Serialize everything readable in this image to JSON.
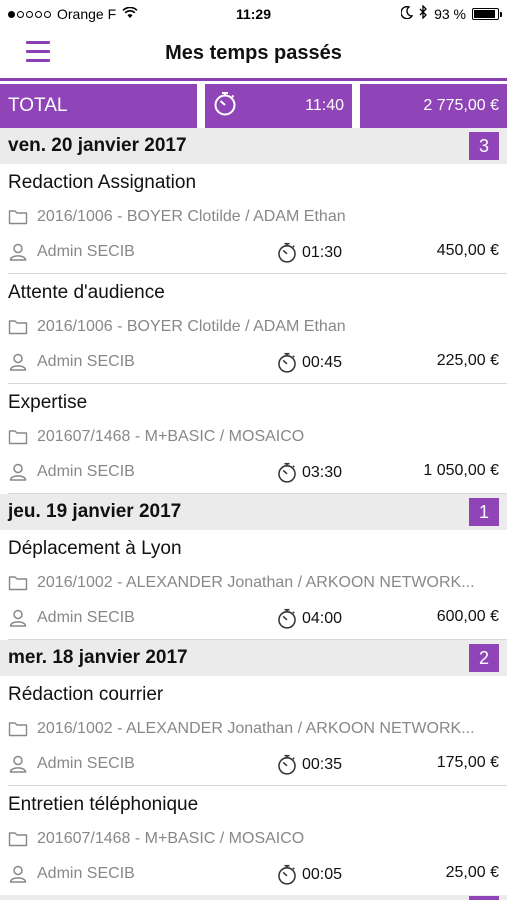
{
  "status_bar": {
    "carrier": "Orange F",
    "time": "11:29",
    "battery": "93 %",
    "battery_level": 0.93
  },
  "header": {
    "title": "Mes temps passés"
  },
  "totals": {
    "label": "TOTAL",
    "duration": "11:40",
    "amount": "2 775,00 €"
  },
  "days": [
    {
      "label": "ven. 20 janvier 2017",
      "count": "3",
      "entries": [
        {
          "title": "Redaction Assignation",
          "folder": "2016/1006 - BOYER Clotilde / ADAM Ethan",
          "user": "Admin SECIB",
          "duration": "01:30",
          "amount": "450,00 €"
        },
        {
          "title": "Attente d'audience",
          "folder": "2016/1006 - BOYER Clotilde / ADAM Ethan",
          "user": "Admin SECIB",
          "duration": "00:45",
          "amount": "225,00 €"
        },
        {
          "title": "Expertise",
          "folder": "201607/1468 - M+BASIC / MOSAICO",
          "user": "Admin SECIB",
          "duration": "03:30",
          "amount": "1 050,00 €"
        }
      ]
    },
    {
      "label": "jeu. 19 janvier 2017",
      "count": "1",
      "entries": [
        {
          "title": "Déplacement à Lyon",
          "folder": "2016/1002 - ALEXANDER Jonathan / ARKOON NETWORK...",
          "user": "Admin SECIB",
          "duration": "04:00",
          "amount": "600,00 €"
        }
      ]
    },
    {
      "label": "mer. 18 janvier 2017",
      "count": "2",
      "entries": [
        {
          "title": "Rédaction courrier",
          "folder": "2016/1002 - ALEXANDER Jonathan / ARKOON NETWORK...",
          "user": "Admin SECIB",
          "duration": "00:35",
          "amount": "175,00 €"
        },
        {
          "title": "Entretien téléphonique",
          "folder": "201607/1468 - M+BASIC / MOSAICO",
          "user": "Admin SECIB",
          "duration": "00:05",
          "amount": "25,00 €"
        }
      ]
    }
  ],
  "icons": {
    "menu": "hamburger-menu-icon",
    "timer": "stopwatch-icon",
    "folder": "folder-icon",
    "user": "user-icon"
  },
  "colors": {
    "accent": "#8f45b7",
    "section_bg": "#ebebeb"
  }
}
